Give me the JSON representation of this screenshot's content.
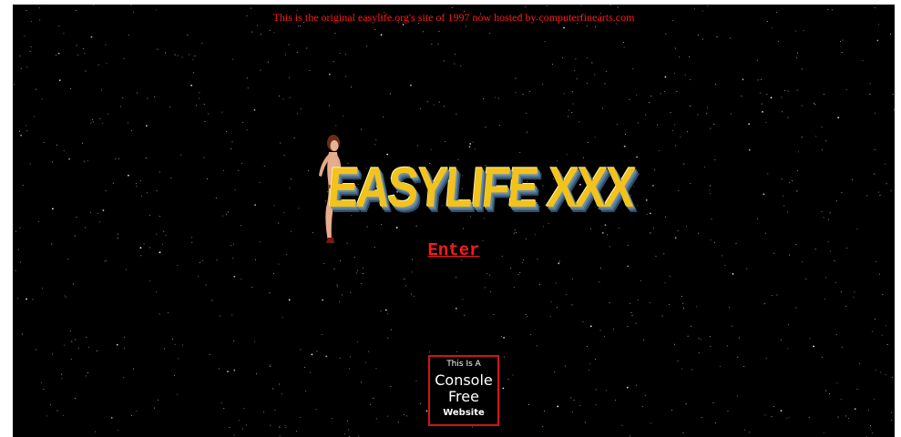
{
  "notice": "This is the original easylife.org's site of 1997 now hosted by computerfinearts.com",
  "logo": {
    "text": "EASYLIFE XXX",
    "colors": {
      "gold": "#f2c21d",
      "blue_shadow": "#4e7290"
    }
  },
  "enter": {
    "label": "Enter"
  },
  "badge": {
    "line1": "This Is A",
    "line2": "Console",
    "line3": "Free",
    "line4": "Website",
    "border_color": "#d41414"
  },
  "colors": {
    "background": "#000000",
    "link_red": "#ff1a1a"
  }
}
